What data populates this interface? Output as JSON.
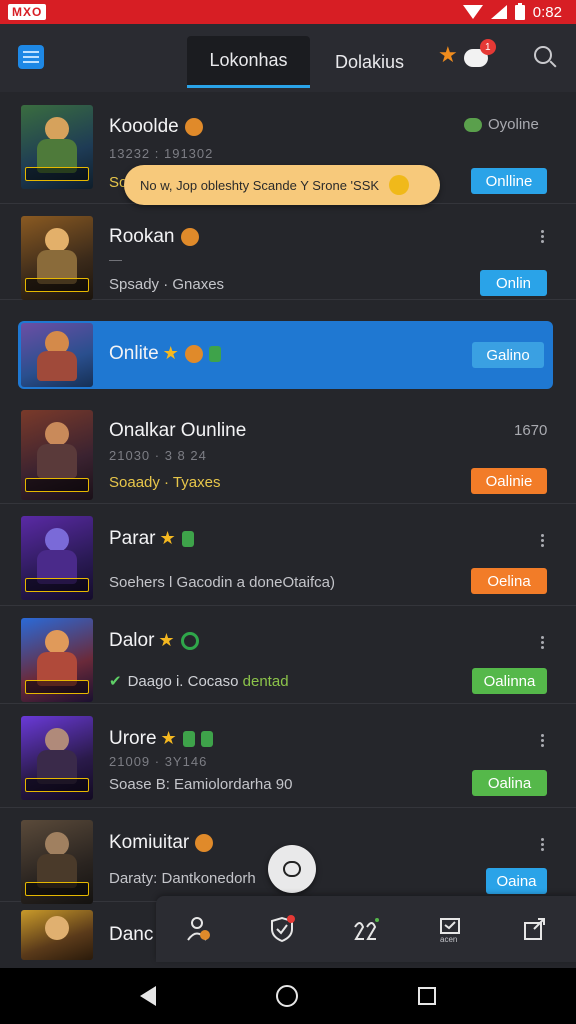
{
  "status": {
    "brand": "MXO",
    "time": "0:82"
  },
  "header": {
    "tabs": [
      {
        "label": "Lokonhas",
        "active": true
      },
      {
        "label": "Dolakius",
        "active": false
      }
    ],
    "notif_count": "1"
  },
  "tooltip": "No w, Jop obleshty Scande Y Srone 'SSK",
  "rows": [
    {
      "title": "Kooolde",
      "sub1": "13232 : 191302",
      "sub2": "So",
      "right_text": "Oyoline",
      "button": "Onlline",
      "button_color": "blue"
    },
    {
      "title": "Rookan",
      "sub1": "—",
      "sub2": "Spsady · Gnaxes",
      "button": "Onlin",
      "button_color": "blue"
    },
    {
      "title": "Onlite",
      "sub1": "",
      "sub2": "",
      "button": "Galino",
      "button_color": "blue",
      "selected": true
    },
    {
      "title": "Onalkar Ounline",
      "sub1": "21030 · 3 8 24",
      "sub2": "Soaady · Tyaxes",
      "right_text": "1670",
      "button": "Oalinie",
      "button_color": "orange"
    },
    {
      "title": "Parar",
      "sub1": "",
      "sub2": "Soehers l Gacodin a doneOtaifca)",
      "button": "Oelina",
      "button_color": "orange"
    },
    {
      "title": "Dalor",
      "sub1": "",
      "sub2": "Daago i. Cocaso",
      "sub2_extra": "dentad",
      "button": "Oalinna",
      "button_color": "green"
    },
    {
      "title": "Urore",
      "sub1": "21009 · 3Y146",
      "sub2": "Soase B: Eamiolordarha 90",
      "button": "Oalina",
      "button_color": "green"
    },
    {
      "title": "Komiuitar",
      "sub1": "",
      "sub2": "Daraty: Dantkonedorh",
      "button": "Oaina",
      "button_color": "blue"
    },
    {
      "title": "Danc",
      "sub1": "",
      "sub2": ""
    }
  ],
  "bottom_nav": {
    "items": [
      "profile-icon",
      "shield-icon",
      "people-icon",
      "inbox-icon",
      "share-icon"
    ],
    "inbox_label": "acen"
  }
}
